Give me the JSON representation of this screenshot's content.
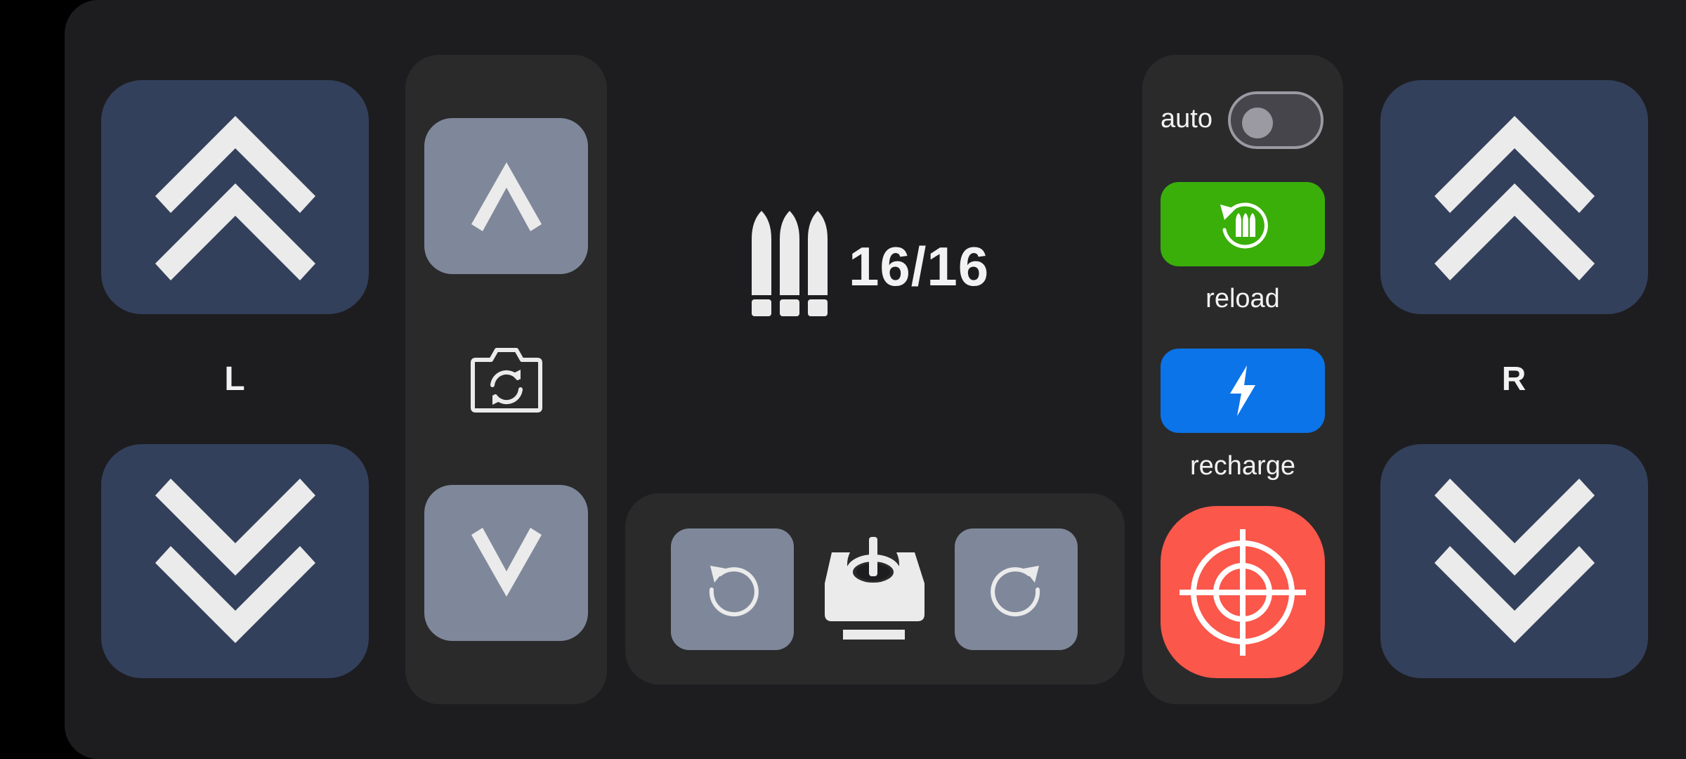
{
  "left_track": {
    "label": "L",
    "up_icon": "double-chevron-up-icon",
    "down_icon": "double-chevron-down-icon"
  },
  "right_track": {
    "label": "R",
    "up_icon": "double-chevron-up-icon",
    "down_icon": "double-chevron-down-icon"
  },
  "camera_panel": {
    "up_icon": "chevron-up-icon",
    "switch_icon": "camera-switch-icon",
    "down_icon": "chevron-down-icon"
  },
  "ammo": {
    "icon": "bullets-icon",
    "count": "16/16"
  },
  "turret_panel": {
    "rotate_left_icon": "rotate-ccw-icon",
    "turret_icon": "turret-icon",
    "rotate_right_icon": "rotate-cw-icon"
  },
  "controls": {
    "auto_label": "auto",
    "auto_enabled": false,
    "reload_label": "reload",
    "reload_icon": "reload-bullets-icon",
    "recharge_label": "recharge",
    "recharge_icon": "lightning-icon",
    "fire_icon": "crosshair-icon"
  },
  "colors": {
    "background": "#1d1d20",
    "panel": "#2a2a2b",
    "track_button": "#33405b",
    "step_button": "#7f889a",
    "reload": "#3aaf0a",
    "recharge": "#0b74e8",
    "fire": "#fb574b"
  }
}
